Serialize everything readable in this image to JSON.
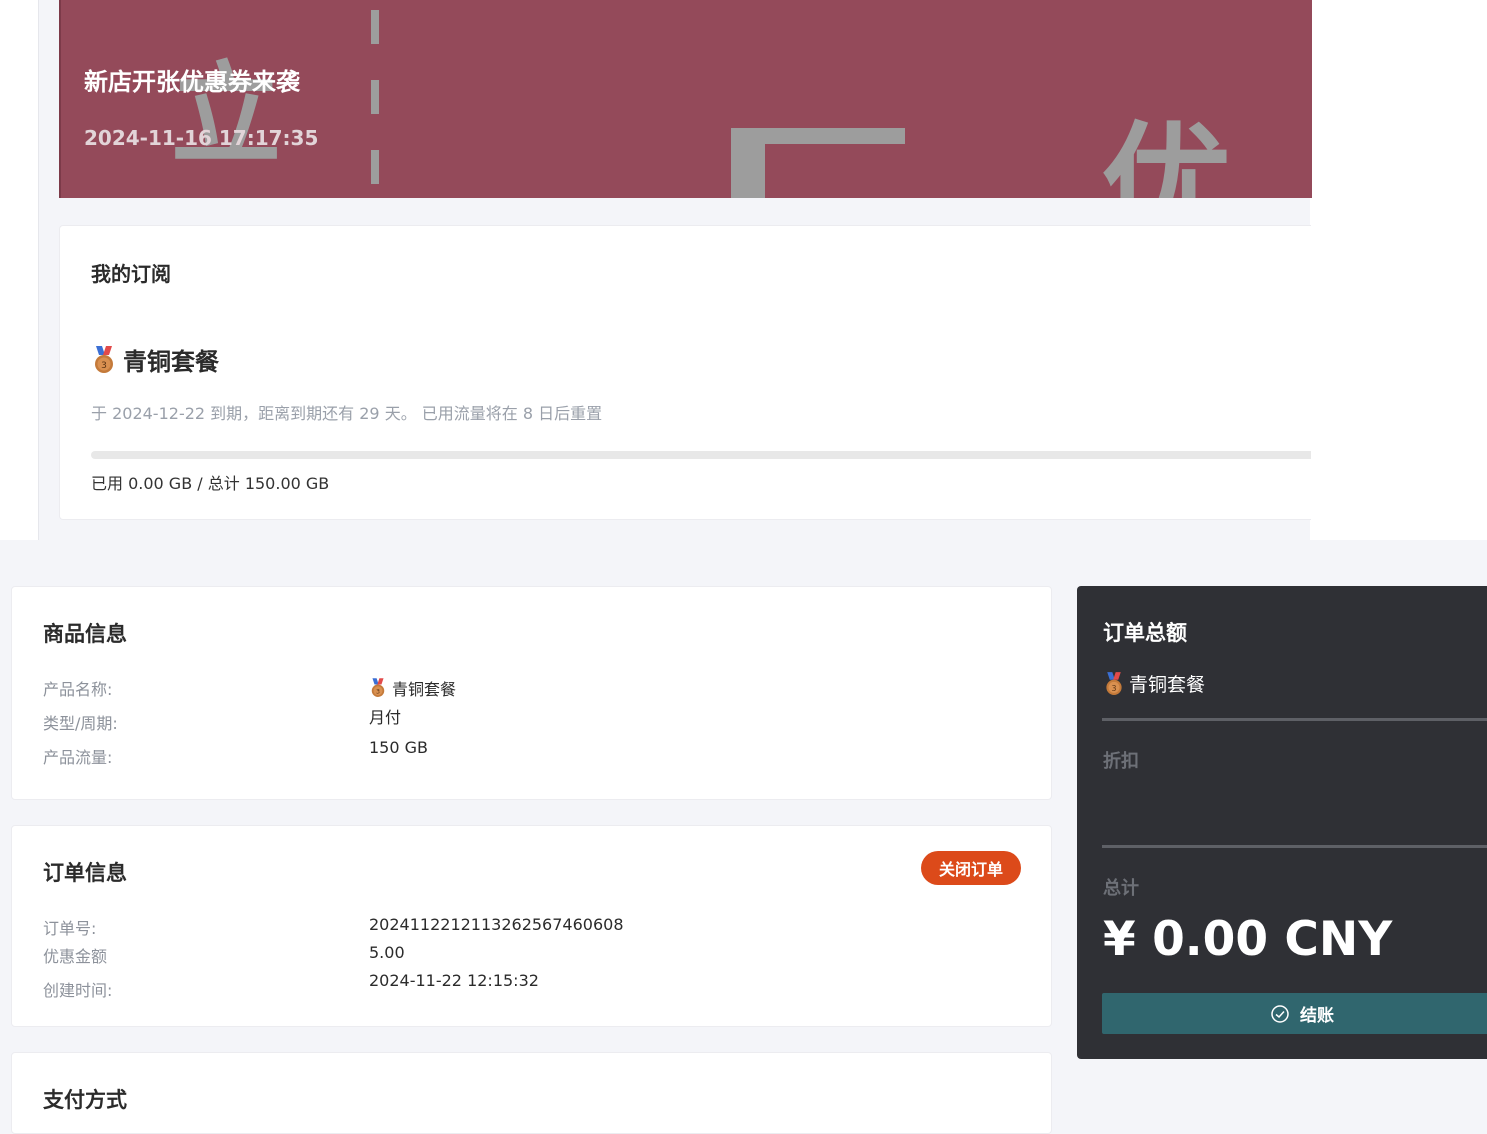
{
  "banner": {
    "title": "新店开张优惠券来袭",
    "time": "2024-11-16 17:17:35",
    "bg_color": "#944a5a"
  },
  "subscription": {
    "header": "我的订阅",
    "plan_name": "青铜套餐",
    "expire_text": "于 2024-12-22 到期，距离到期还有 29 天。 已用流量将在 8 日后重置",
    "usage_text": "已用 0.00 GB / 总计 150.00 GB",
    "usage_fraction": 0.0
  },
  "product_info": {
    "title": "商品信息",
    "rows": [
      {
        "label": "产品名称:",
        "value": "青铜套餐",
        "icon": "bronze-medal-icon"
      },
      {
        "label": "类型/周期:",
        "value": "月付"
      },
      {
        "label": "产品流量:",
        "value": "150 GB"
      }
    ]
  },
  "order_info": {
    "title": "订单信息",
    "close_label": "关闭订单",
    "close_color": "#dc4a1a",
    "rows": [
      {
        "label": "订单号:",
        "value": "2024112212113262567460608"
      },
      {
        "label": "优惠金额",
        "value": "5.00"
      },
      {
        "label": "创建时间:",
        "value": "2024-11-22 12:15:32"
      }
    ]
  },
  "payment": {
    "title": "支付方式"
  },
  "summary": {
    "title": "订单总额",
    "item": "青铜套餐",
    "discount_label": "折扣",
    "total_label": "总计",
    "total_value": "¥ 0.00 CNY",
    "checkout_label": "结账",
    "checkout_color": "#30666e",
    "bg_color": "#2f3035"
  }
}
